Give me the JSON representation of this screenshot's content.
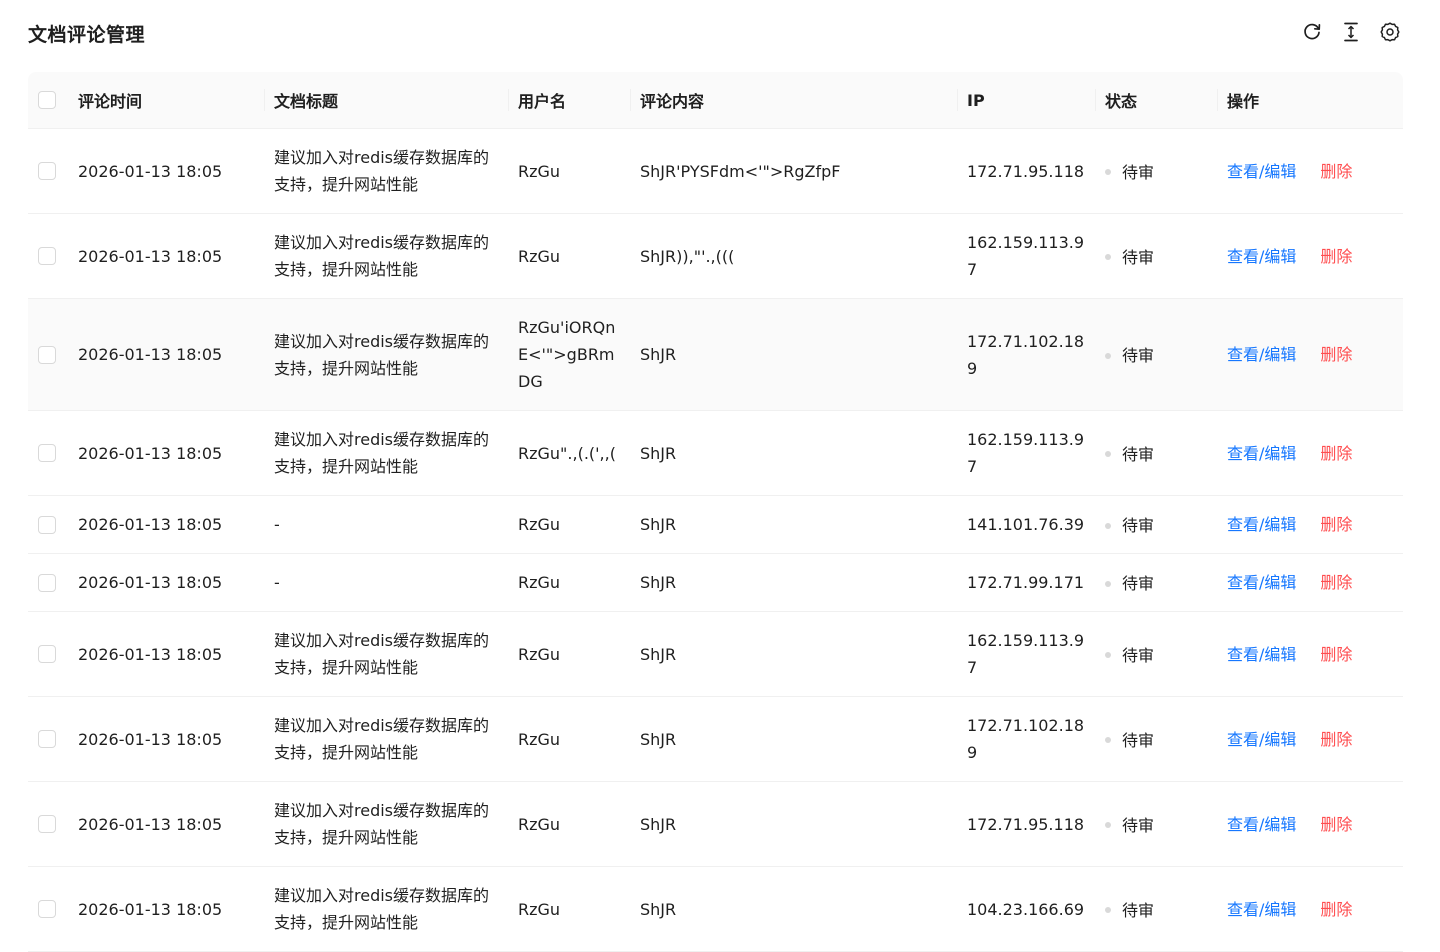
{
  "header": {
    "title": "文档评论管理",
    "icons": [
      "reload-icon",
      "column-height-icon",
      "setting-icon"
    ]
  },
  "table": {
    "columns": [
      "评论时间",
      "文档标题",
      "用户名",
      "评论内容",
      "IP",
      "状态",
      "操作"
    ],
    "actions": {
      "edit": "查看/编辑",
      "delete": "删除"
    },
    "rows": [
      {
        "time": "2026-01-13 18:05",
        "title": "建议加入对redis缓存数据库的支持，提升网站性能",
        "user": "RzGu",
        "content": "ShJR'PYSFdm<'\">RgZfpF",
        "ip": "172.71.95.118",
        "status": "待审"
      },
      {
        "time": "2026-01-13 18:05",
        "title": "建议加入对redis缓存数据库的支持，提升网站性能",
        "user": "RzGu",
        "content": "ShJR)),\"'.,(((",
        "ip": "162.159.113.97",
        "status": "待审"
      },
      {
        "time": "2026-01-13 18:05",
        "title": "建议加入对redis缓存数据库的支持，提升网站性能",
        "user": "RzGu'iORQnE<'\">gBRmDG",
        "content": "ShJR",
        "ip": "172.71.102.189",
        "status": "待审"
      },
      {
        "time": "2026-01-13 18:05",
        "title": "建议加入对redis缓存数据库的支持，提升网站性能",
        "user": "RzGu\".,(.(',,(",
        "content": "ShJR",
        "ip": "162.159.113.97",
        "status": "待审"
      },
      {
        "time": "2026-01-13 18:05",
        "title": "-",
        "user": "RzGu",
        "content": "ShJR",
        "ip": "141.101.76.39",
        "status": "待审"
      },
      {
        "time": "2026-01-13 18:05",
        "title": "-",
        "user": "RzGu",
        "content": "ShJR",
        "ip": "172.71.99.171",
        "status": "待审"
      },
      {
        "time": "2026-01-13 18:05",
        "title": "建议加入对redis缓存数据库的支持，提升网站性能",
        "user": "RzGu",
        "content": "ShJR",
        "ip": "162.159.113.97",
        "status": "待审"
      },
      {
        "time": "2026-01-13 18:05",
        "title": "建议加入对redis缓存数据库的支持，提升网站性能",
        "user": "RzGu",
        "content": "ShJR",
        "ip": "172.71.102.189",
        "status": "待审"
      },
      {
        "time": "2026-01-13 18:05",
        "title": "建议加入对redis缓存数据库的支持，提升网站性能",
        "user": "RzGu",
        "content": "ShJR",
        "ip": "172.71.95.118",
        "status": "待审"
      },
      {
        "time": "2026-01-13 18:05",
        "title": "建议加入对redis缓存数据库的支持，提升网站性能",
        "user": "RzGu",
        "content": "ShJR",
        "ip": "104.23.166.69",
        "status": "待审"
      }
    ]
  },
  "colors": {
    "link": "#1677ff",
    "danger": "#ff4d4f",
    "status_dot": "#d9d9d9",
    "header_bg": "#fafafa"
  }
}
